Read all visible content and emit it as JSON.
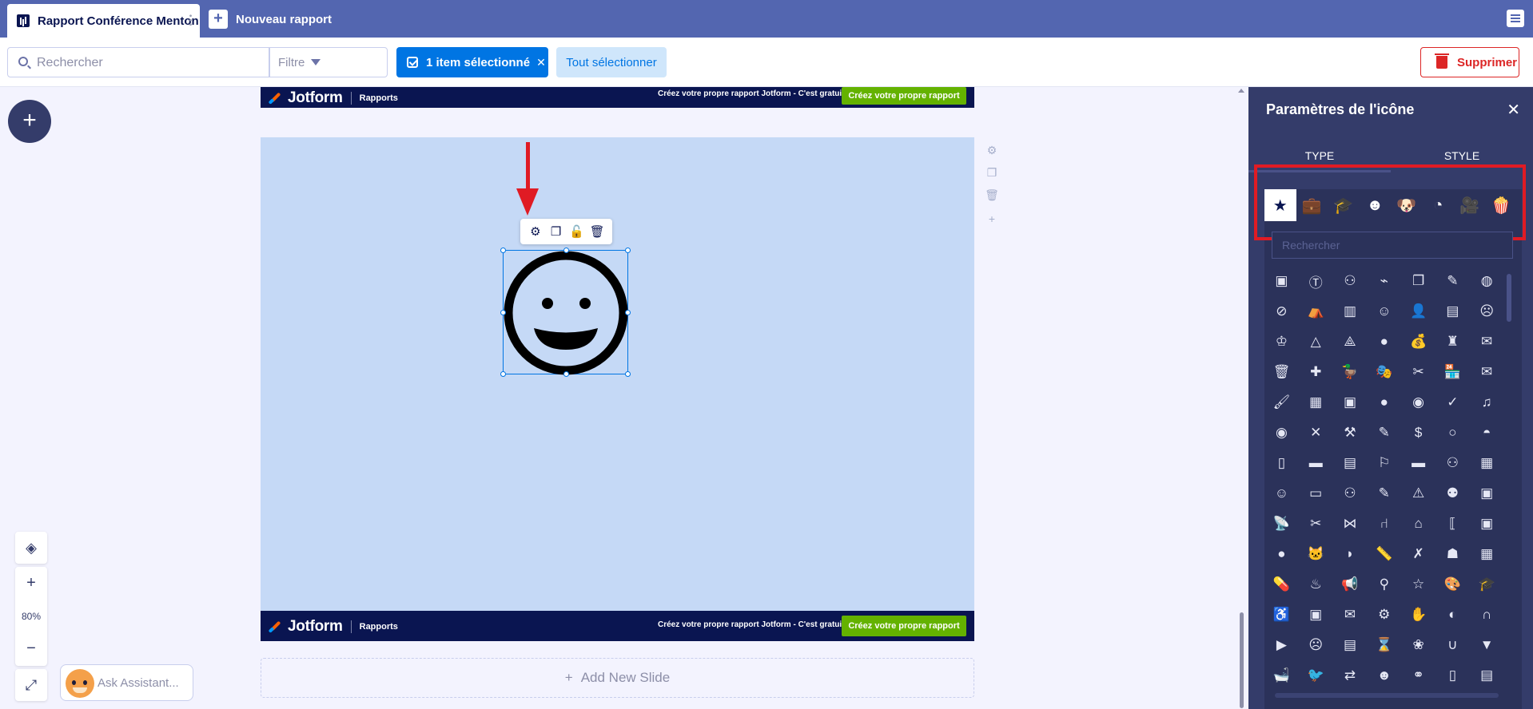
{
  "tabs": {
    "active_label": "Rapport Conférence Menton",
    "new_label": "Nouveau rapport"
  },
  "toolbar": {
    "search_placeholder": "Rechercher",
    "filter_label": "Filtre",
    "selected_label": "1 item sélectionné",
    "select_all_label": "Tout sélectionner",
    "delete_label": "Supprimer"
  },
  "slide": {
    "brand_name": "Jotform",
    "brand_sub": "Rapports",
    "promo_text": "Créez votre propre rapport Jotform - C'est gratuit",
    "promo_button": "Créez votre propre rapport",
    "selected_element_icon": "smile-icon"
  },
  "canvas": {
    "add_slide_label": "Add New Slide",
    "zoom_level": "80%",
    "assistant_label": "Ask Assistant..."
  },
  "panel": {
    "title": "Paramètres de l'icône",
    "tab_type": "TYPE",
    "tab_style": "STYLE",
    "search_placeholder": "Rechercher",
    "categories": [
      "star",
      "briefcase",
      "graduation-cap",
      "smile",
      "dog",
      "pacman",
      "video-camera",
      "popcorn"
    ],
    "active_category": "star"
  },
  "colors": {
    "topbar": "#5366b0",
    "accent": "#0075e3",
    "danger": "#dc2626",
    "panel": "#343c6a",
    "slide_bg": "#c5d9f6",
    "annotation": "#e01b24"
  }
}
